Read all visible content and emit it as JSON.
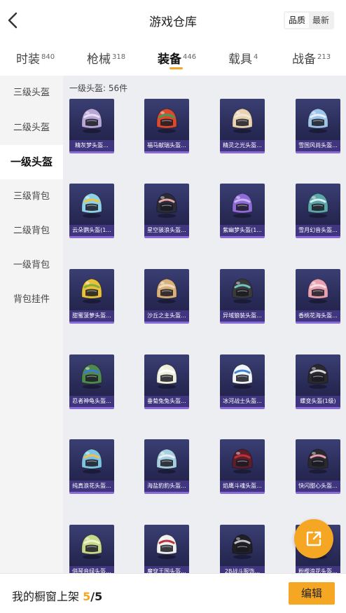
{
  "header": {
    "title": "游戏仓库",
    "sort_options": [
      {
        "label": "品质",
        "active": true
      },
      {
        "label": "最新",
        "active": false
      }
    ]
  },
  "tabs": [
    {
      "label": "时装",
      "count": "840",
      "active": false
    },
    {
      "label": "枪械",
      "count": "318",
      "active": false
    },
    {
      "label": "装备",
      "count": "446",
      "active": true
    },
    {
      "label": "载具",
      "count": "4",
      "active": false
    },
    {
      "label": "战备",
      "count": "213",
      "active": false
    }
  ],
  "sidebar": [
    {
      "label": "三级头盔",
      "active": false
    },
    {
      "label": "二级头盔",
      "active": false
    },
    {
      "label": "一级头盔",
      "active": true
    },
    {
      "label": "三级背包",
      "active": false
    },
    {
      "label": "二级背包",
      "active": false
    },
    {
      "label": "一级背包",
      "active": false
    },
    {
      "label": "背包挂件",
      "active": false
    }
  ],
  "section_label": "一级头盔: 56件",
  "items": [
    {
      "name": "精灰梦头盔...",
      "color": "#b9a7d8",
      "accent": "#e8dff5"
    },
    {
      "name": "福马献瑞头盔...",
      "color": "#d94a2e",
      "accent": "#3aa05a"
    },
    {
      "name": "精灵之光头盔...",
      "color": "#e9d3b3",
      "accent": "#f3e8d6"
    },
    {
      "name": "雪国风尚头盔...",
      "color": "#9ec4ea",
      "accent": "#e6f0fa"
    },
    {
      "name": "云朵鹦头盔(1...",
      "color": "#8fd0ea",
      "accent": "#f0c63a"
    },
    {
      "name": "星空骇浪头盔...",
      "color": "#2b2b3a",
      "accent": "#e8a9a0"
    },
    {
      "name": "紫幽梦头盔(1...",
      "color": "#8f6bd9",
      "accent": "#c9b3f2"
    },
    {
      "name": "雪月幻音头盔...",
      "color": "#5aa6a8",
      "accent": "#d8eef0"
    },
    {
      "name": "甜蜜菠萝头盔...",
      "color": "#e9c23a",
      "accent": "#7fae3a"
    },
    {
      "name": "沙丘之主头盔...",
      "color": "#d9b07a",
      "accent": "#f0dcc0"
    },
    {
      "name": "异域狼装头盔...",
      "color": "#3a3a3a",
      "accent": "#6fc6c4"
    },
    {
      "name": "香桃花海头盔...",
      "color": "#e9a0b0",
      "accent": "#f7dfe5"
    },
    {
      "name": "忍者神龟头盔...",
      "color": "#4f8a4a",
      "accent": "#3a7ad9"
    },
    {
      "name": "垂菊兔兔头盔...",
      "color": "#eeeedd",
      "accent": "#ffffff"
    },
    {
      "name": "冰河战士头盔...",
      "color": "#f2f4f7",
      "accent": "#3a86d9"
    },
    {
      "name": "蝶变头盔(1级)",
      "color": "#2a2a2e",
      "accent": "#d8d8dd"
    },
    {
      "name": "纯真浪花头盔...",
      "color": "#7fc4e0",
      "accent": "#f0c050"
    },
    {
      "name": "海盐豹豹头盔...",
      "color": "#a7cfe0",
      "accent": "#e8f0f5"
    },
    {
      "name": "焰鹰斗魂头盔...",
      "color": "#5a1f2a",
      "accent": "#c0303a"
    },
    {
      "name": "快闪甜心头盔...",
      "color": "#2a2a2e",
      "accent": "#e89ab0"
    },
    {
      "name": "俏琴音绿头盔...",
      "color": "#c9d98a",
      "accent": "#eef3d0"
    },
    {
      "name": "魔穿王国头盔...",
      "color": "#f0f0f0",
      "accent": "#c0303a"
    },
    {
      "name": "2B战斗服饰...",
      "color": "#1f1f24",
      "accent": "#bfbfc6"
    },
    {
      "name": "粉樱浪花头盔...",
      "color": "#e79ab3",
      "accent": "#f7dce6"
    }
  ],
  "fab": {
    "icon": "share-out-icon"
  },
  "bottom": {
    "shelf_label": "我的橱窗上架",
    "shelf_count": "5",
    "shelf_total": "/5",
    "edit_label": "编辑"
  },
  "colors": {
    "accent": "#f5a623",
    "card_bg": "#2a2c58",
    "card_border": "#8a6ad8"
  }
}
